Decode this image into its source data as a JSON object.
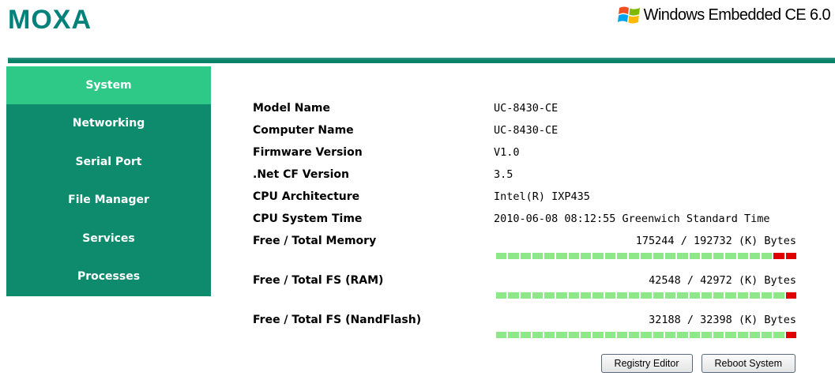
{
  "header": {
    "logo": "MOXA",
    "os_name": "Windows Embedded CE 6.0"
  },
  "sidebar": {
    "items": [
      {
        "label": "System",
        "active": true
      },
      {
        "label": "Networking"
      },
      {
        "label": "Serial Port"
      },
      {
        "label": "File Manager"
      },
      {
        "label": "Services"
      },
      {
        "label": "Processes"
      }
    ]
  },
  "info": {
    "model_name": {
      "label": "Model Name",
      "value": "UC-8430-CE"
    },
    "computer_name": {
      "label": "Computer Name",
      "value": "UC-8430-CE"
    },
    "firmware": {
      "label": "Firmware Version",
      "value": "V1.0"
    },
    "netcf": {
      "label": ".Net CF Version",
      "value": "3.5"
    },
    "cpu_arch": {
      "label": "CPU Architecture",
      "value": "Intel(R) IXP435"
    },
    "cpu_time": {
      "label": "CPU System Time",
      "value": "2010-06-08 08:12:55 Greenwich Standard Time"
    },
    "memory": {
      "label": "Free / Total Memory",
      "value": "175244 / 192732 (K) Bytes",
      "free": 175244,
      "total": 192732
    },
    "fs_ram": {
      "label": "Free / Total FS (RAM)",
      "value": "42548 / 42972 (K) Bytes",
      "free": 42548,
      "total": 42972
    },
    "fs_nand": {
      "label": "Free / Total FS (NandFlash)",
      "value": "32188 / 32398 (K) Bytes",
      "free": 32188,
      "total": 32398
    }
  },
  "colors": {
    "accent": "#0e8a6d",
    "active": "#2ec887",
    "bar_free": "#8ee88a",
    "bar_used": "#e00000"
  },
  "buttons": {
    "registry_editor": "Registry Editor",
    "reboot_system": "Reboot System"
  }
}
